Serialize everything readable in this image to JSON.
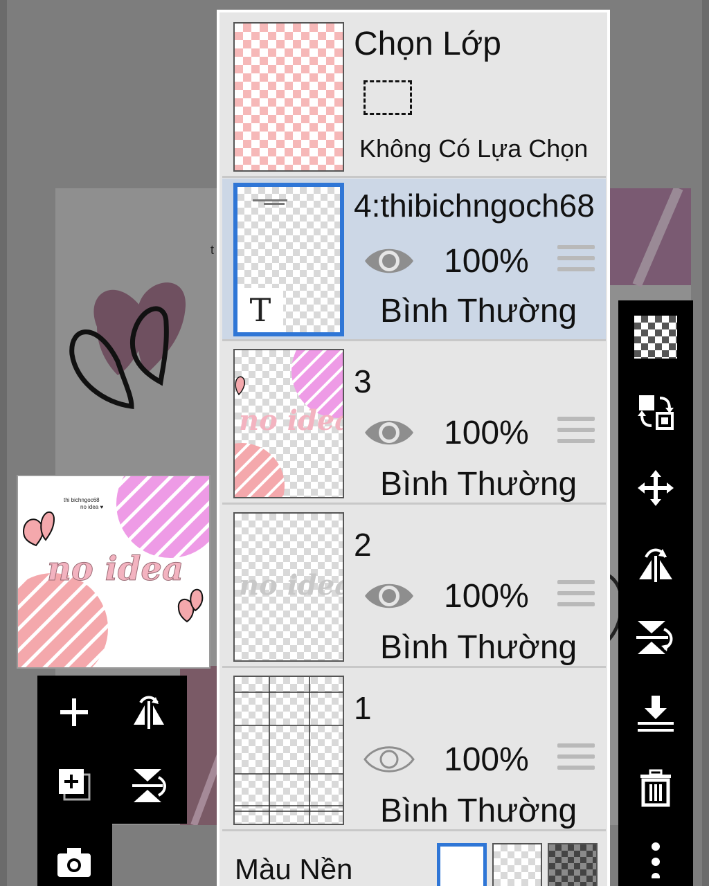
{
  "selection": {
    "title": "Chọn Lớp",
    "status": "Không Có Lựa Chọn"
  },
  "layers": [
    {
      "name": "4:thibichngoch68",
      "opacity": "100%",
      "blend": "Bình Thường",
      "visible": true,
      "type": "text",
      "text_badge": "T",
      "selected": true
    },
    {
      "name": "3",
      "opacity": "100%",
      "blend": "Bình Thường",
      "visible": true,
      "thumb_text": "no idea"
    },
    {
      "name": "2",
      "opacity": "100%",
      "blend": "Bình Thường",
      "visible": true,
      "thumb_text": "no idea"
    },
    {
      "name": "1",
      "opacity": "100%",
      "blend": "Bình Thường",
      "visible": false
    }
  ],
  "background": {
    "label": "Màu Nền",
    "options": [
      "white",
      "transparent",
      "dark-checker"
    ],
    "selected": "white"
  },
  "navigator": {
    "title_text": "no idea",
    "caption_line1": "thi bichngoc68",
    "caption_line2": "no idea ♥"
  },
  "colors": {
    "panel_bg": "#e6e6e6",
    "selected_bg": "#ccd7e6",
    "accent_blue": "#2f76d6",
    "pink_light": "#f6b8b8",
    "pink_magenta": "#ee9be6",
    "toolbar_bg": "#000000"
  }
}
